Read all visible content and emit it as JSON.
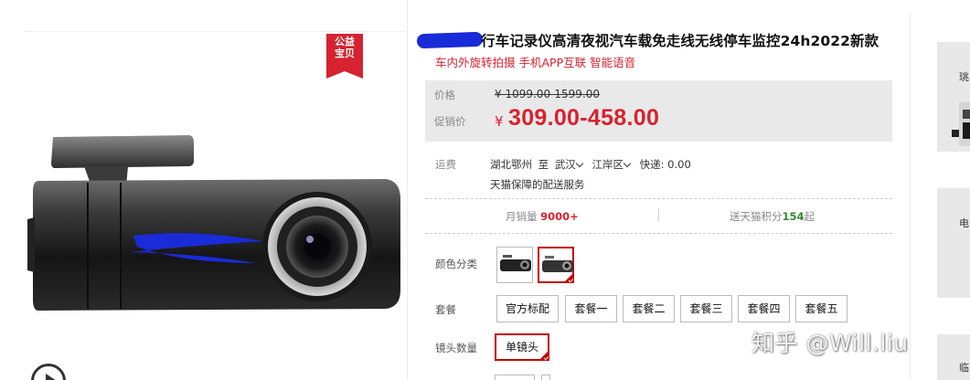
{
  "product": {
    "title": "行车记录仪高清夜视汽车载免走线无线停车监控24h2022新款",
    "subtitle": "车内外旋转拍摄 手机APP互联 智能语音",
    "badge": "公益\n宝贝",
    "image_alt": "dash-cam"
  },
  "price": {
    "label": "价格",
    "original": "¥ 1099.00-1599.00",
    "promo_label": "促销价",
    "currency": "¥",
    "promo": "309.00-458.00"
  },
  "shipping": {
    "label": "运费",
    "origin": "湖北鄂州",
    "to": "至",
    "city": "武汉",
    "district": "江岸区",
    "express": "快递: 0.00",
    "service": "天猫保障的配送服务"
  },
  "stats": {
    "monthly_sales_label": "月销量",
    "monthly_sales": "9000+",
    "points_prefix": "送天猫积分",
    "points": "154",
    "points_suffix": "起"
  },
  "options": {
    "color_label": "颜色分类",
    "package_label": "套餐",
    "packages": [
      "官方标配",
      "套餐一",
      "套餐二",
      "套餐三",
      "套餐四",
      "套餐五"
    ],
    "lens_label": "镜头数量",
    "lens_value": "单镜头"
  },
  "sidebar": {
    "card1": "珧",
    "card2": "电",
    "card3": "临"
  },
  "watermark": "知乎 @Will.liu",
  "colors": {
    "accent": "#d7222f",
    "selected_border": "#c40000",
    "points_green": "#2f8a2f"
  }
}
